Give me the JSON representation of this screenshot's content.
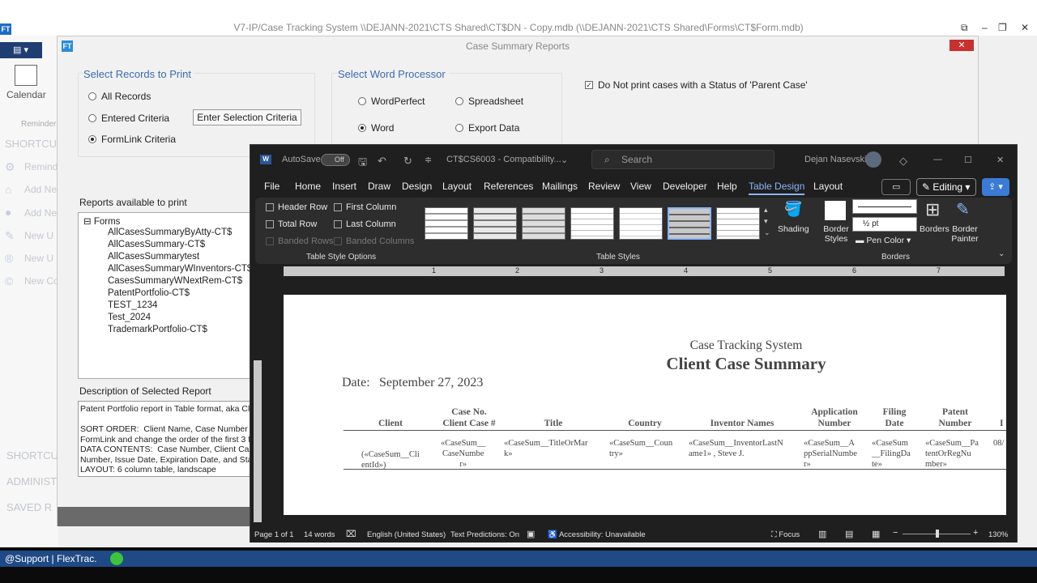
{
  "app": {
    "title": "V7-IP/Case Tracking System \\\\DEJANN-2021\\CTS Shared\\CT$DN - Copy.mdb (\\\\DEJANN-2021\\CTS Shared\\Forms\\CT$Form.mdb)",
    "logo": "FT",
    "calendar_label": "Calendar",
    "reminder_label": "Reminder",
    "shortcuts_label": "SHORTCU",
    "shortcut_items": [
      "Remind",
      "Add Ne",
      "Add Ne",
      "New U",
      "New U",
      "New Co"
    ],
    "bottom_labels": [
      "SHORTCU",
      "ADMINIST",
      "SAVED R"
    ],
    "status_text": "@Support | FlexTrac.",
    "status_color": "#3cc43c"
  },
  "dialog": {
    "title": "Case Summary Reports",
    "logo": "FT",
    "close": "✕",
    "select_records": {
      "title": "Select Records to Print",
      "options": [
        "All Records",
        "Entered Criteria",
        "FormLink Criteria"
      ],
      "selected": "FormLink Criteria",
      "criteria_button": "Enter Selection Criteria"
    },
    "select_word_processor": {
      "title": "Select Word Processor",
      "options": [
        "WordPerfect",
        "Spreadsheet",
        "Word",
        "Export Data"
      ],
      "selected": "Word"
    },
    "parent_case_checkbox": {
      "label": "Do Not print cases with a Status of 'Parent Case'",
      "checked": true
    },
    "reports_label": "Reports available to print",
    "tree": {
      "root": "Forms",
      "items": [
        "AllCasesSummaryByAtty-CT$",
        "AllCasesSummary-CT$",
        "AllCasesSummarytest",
        "AllCasesSummaryWInventors-CT$",
        "CasesSummaryWNextRem-CT$",
        "PatentPortfolio-CT$",
        "TEST_1234",
        "Test_2024",
        "TrademarkPortfolio-CT$"
      ]
    },
    "description_label": "Description of Selected Report",
    "description_text": "Patent Portfolio report in Table format, aka Clie\n\nSORT ORDER:  Client Name, Case Number  (3\nFormLink and change the order of the first 3 fie\nDATA CONTENTS:  Case Number, Client Case\nNumber, Issue Date, Expiration Date, and Stat\nLAYOUT: 6 column table, landscape"
  },
  "word": {
    "autosave": "AutoSave",
    "autosave_state": "Off",
    "doc_title": "CT$CS6003  -  Compatibility...",
    "search_placeholder": "Search",
    "user": "Dejan Nasevski",
    "tabs": [
      "File",
      "Home",
      "Insert",
      "Draw",
      "Design",
      "Layout",
      "References",
      "Mailings",
      "Review",
      "View",
      "Developer",
      "Help",
      "Table Design",
      "Layout"
    ],
    "active_tab": "Table Design",
    "editing": "Editing",
    "table_style_options": {
      "label": "Table Style Options",
      "items": [
        "Header Row",
        "First Column",
        "Total Row",
        "Last Column",
        "Banded Rows",
        "Banded Columns"
      ]
    },
    "table_styles_label": "Table Styles",
    "shading_label": "Shading",
    "border_styles_label": "Border Styles",
    "pen_weight": "½ pt",
    "pen_color": "Pen Color",
    "borders_label": "Borders",
    "border_painter_label": "Border Painter",
    "borders_group_label": "Borders",
    "ruler_numbers": [
      "1",
      "2",
      "3",
      "4",
      "5",
      "6",
      "7"
    ],
    "document": {
      "system": "Case Tracking System",
      "heading": "Client Case Summary",
      "date_label": "Date:",
      "date_value": "September 27, 2023",
      "columns": [
        "Client",
        "Case No.\nClient Case #",
        "Title",
        "Country",
        "Inventor Names",
        "Application\nNumber",
        "Filing\nDate",
        "Patent\nNumber",
        "I"
      ],
      "row": [
        "(«CaseSum__Cli\nentId»)",
        "«CaseSum__\nCaseNumbe\nr»",
        "«CaseSum__TitleOrMar\nk»",
        "«CaseSum__Coun\ntry»",
        "«CaseSum__InventorLastN\name1» , Steve J.",
        "«CaseSum__A\nppSerialNumbe\nr»",
        "«CaseSum\n__FilingDa\nte»",
        "«CaseSum__Pa\ntentOrRegNu\nmber»",
        "08/"
      ]
    },
    "status": {
      "page": "Page 1 of 1",
      "words": "14 words",
      "language": "English (United States)",
      "predictions": "Text Predictions: On",
      "accessibility": "Accessibility: Unavailable",
      "focus": "Focus",
      "zoom": "130%"
    }
  }
}
